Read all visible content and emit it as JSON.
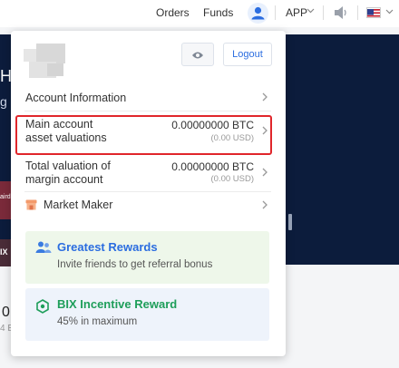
{
  "nav": {
    "orders": "Orders",
    "funds": "Funds",
    "app": "APP"
  },
  "background": {
    "hero_fragment_1": "H",
    "hero_fragment_2": "g C",
    "hero_fragment_3": "aird",
    "hero_fragment_4": "IX",
    "below_number": "0",
    "below_sub": "4 E"
  },
  "dropdown": {
    "logout_label": "Logout",
    "rows": [
      {
        "label": "Account Information"
      },
      {
        "label_line1": "Main account",
        "label_line2": "asset valuations",
        "value": "0.00000000 BTC",
        "sub": "(0.00 USD)"
      },
      {
        "label_line1": "Total valuation of",
        "label_line2": "margin account",
        "value": "0.00000000 BTC",
        "sub": "(0.00 USD)"
      },
      {
        "label": "Market Maker"
      }
    ],
    "promos": [
      {
        "title": "Greatest Rewards",
        "desc": "Invite friends to get referral bonus",
        "color": "#2b6de0"
      },
      {
        "title": "BIX Incentive Reward",
        "desc": "45% in maximum",
        "color": "#1e9e5a"
      }
    ]
  },
  "colors": {
    "accent": "#2b6de0",
    "highlight": "#e0262b",
    "hero": "#0c1c3c"
  }
}
